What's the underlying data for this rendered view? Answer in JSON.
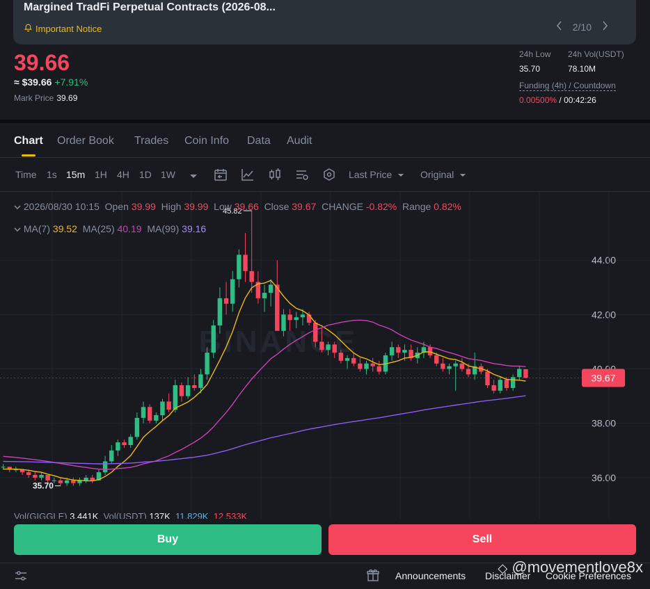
{
  "notice": {
    "title": "Margined TradFi Perpetual Contracts (2026-08...",
    "link": "Important Notice",
    "pager": "2/10"
  },
  "price": {
    "last": "39.66",
    "usd": "≈ $39.66",
    "change": "+7.91%",
    "mark_label": "Mark Price",
    "mark_value": "39.69"
  },
  "stats": {
    "low_label": "24h Low",
    "low_value": "35.70",
    "vol_label": "24h Vol(USDT)",
    "vol_value": "78.10M",
    "funding_label": "Funding (4h) / Countdown",
    "funding_rate": "0.00500%",
    "funding_sep": " / ",
    "countdown": "00:42:26"
  },
  "tabs": [
    "Chart",
    "Order Book",
    "Trades",
    "Coin Info",
    "Data",
    "Audit"
  ],
  "toolbar": {
    "time_label": "Time",
    "intervals": [
      "1s",
      "15m",
      "1H",
      "4H",
      "1D",
      "1W"
    ],
    "price_type": "Last Price",
    "view": "Original"
  },
  "ohlc": {
    "datetime": "2026/08/30 10:15",
    "open_label": "Open",
    "open": "39.99",
    "high_label": "High",
    "high": "39.99",
    "low_label": "Low",
    "low": "39.66",
    "close_label": "Close",
    "close": "39.67",
    "change_label": "CHANGE",
    "change": "-0.82%",
    "range_label": "Range",
    "range": "0.82%"
  },
  "ma": {
    "ma7_label": "MA(7)",
    "ma7": "39.52",
    "ma25_label": "MA(25)",
    "ma25": "40.19",
    "ma99_label": "MA(99)",
    "ma99": "39.16"
  },
  "volume": {
    "label": "Vol(GIGGLE)",
    "value": "3.441K",
    "usdt_label": "Vol(USDT)",
    "usdt": "137K",
    "v1": "11.829K",
    "v2": "12.533K"
  },
  "chart_data": {
    "type": "candlestick",
    "y_ticks": [
      "44.00",
      "42.00",
      "40.00",
      "38.00",
      "36.00"
    ],
    "ylim": [
      35,
      46
    ],
    "last_price_tag": "39.67",
    "high_marker": "45.82",
    "low_marker": "35.70",
    "watermark": "BINANCE",
    "colors": {
      "up": "#2ebd85",
      "down": "#f6465d",
      "ma7": "#f0b90b",
      "ma25": "#c941b5",
      "ma99": "#8b5cf6"
    },
    "candles": [
      [
        36.4,
        36.5,
        36.3,
        36.4
      ],
      [
        36.4,
        36.4,
        36.2,
        36.3
      ],
      [
        36.3,
        36.4,
        36.2,
        36.3
      ],
      [
        36.3,
        36.3,
        36.1,
        36.2
      ],
      [
        36.2,
        36.3,
        36.0,
        36.1
      ],
      [
        36.1,
        36.2,
        35.9,
        36.0
      ],
      [
        36.0,
        36.2,
        35.9,
        36.1
      ],
      [
        36.1,
        36.1,
        35.8,
        35.9
      ],
      [
        35.9,
        36.0,
        35.8,
        35.9
      ],
      [
        35.9,
        36.0,
        35.7,
        35.8
      ],
      [
        35.8,
        36.0,
        35.7,
        35.9
      ],
      [
        35.9,
        36.0,
        35.7,
        35.8
      ],
      [
        35.8,
        36.0,
        35.7,
        35.9
      ],
      [
        35.9,
        36.1,
        35.8,
        36.0
      ],
      [
        36.0,
        36.1,
        35.8,
        35.9
      ],
      [
        35.9,
        36.3,
        35.9,
        36.2
      ],
      [
        36.2,
        36.8,
        36.1,
        36.6
      ],
      [
        36.6,
        37.2,
        36.5,
        37.0
      ],
      [
        37.0,
        37.4,
        36.8,
        37.3
      ],
      [
        37.3,
        37.4,
        37.1,
        37.2
      ],
      [
        37.2,
        37.6,
        37.1,
        37.5
      ],
      [
        37.5,
        38.4,
        37.4,
        38.2
      ],
      [
        38.2,
        38.8,
        38.0,
        38.6
      ],
      [
        38.6,
        38.7,
        38.0,
        38.1
      ],
      [
        38.1,
        38.4,
        38.0,
        38.3
      ],
      [
        38.3,
        38.9,
        38.1,
        38.8
      ],
      [
        38.8,
        39.1,
        38.4,
        38.5
      ],
      [
        38.5,
        39.6,
        38.4,
        39.4
      ],
      [
        39.4,
        39.5,
        38.8,
        39.0
      ],
      [
        39.0,
        39.7,
        38.9,
        39.4
      ],
      [
        39.4,
        39.8,
        39.2,
        39.3
      ],
      [
        39.3,
        40.0,
        39.1,
        39.8
      ],
      [
        39.8,
        40.8,
        39.6,
        40.6
      ],
      [
        40.6,
        41.8,
        40.4,
        41.6
      ],
      [
        41.6,
        43.0,
        41.3,
        42.6
      ],
      [
        42.6,
        43.2,
        42.0,
        42.4
      ],
      [
        42.4,
        43.6,
        42.1,
        43.3
      ],
      [
        43.3,
        44.4,
        43.0,
        44.2
      ],
      [
        44.2,
        45.0,
        43.2,
        43.6
      ],
      [
        43.6,
        45.82,
        42.8,
        43.2
      ],
      [
        43.2,
        43.6,
        42.4,
        42.6
      ],
      [
        42.6,
        43.1,
        42.1,
        42.8
      ],
      [
        42.8,
        43.3,
        42.3,
        43.1
      ],
      [
        43.1,
        44.0,
        41.6,
        41.4
      ],
      [
        41.4,
        42.2,
        41.2,
        42.0
      ],
      [
        42.0,
        42.2,
        41.4,
        41.8
      ],
      [
        41.8,
        42.1,
        41.5,
        41.9
      ],
      [
        41.9,
        42.2,
        41.6,
        42.0
      ],
      [
        42.0,
        42.1,
        41.6,
        41.7
      ],
      [
        41.7,
        41.8,
        40.8,
        41.0
      ],
      [
        41.0,
        41.5,
        40.6,
        40.7
      ],
      [
        40.7,
        41.0,
        40.5,
        40.9
      ],
      [
        40.9,
        41.0,
        40.4,
        40.6
      ],
      [
        40.6,
        40.7,
        40.2,
        40.3
      ],
      [
        40.3,
        40.5,
        40.0,
        40.4
      ],
      [
        40.4,
        40.6,
        40.1,
        40.2
      ],
      [
        40.2,
        40.4,
        39.9,
        40.0
      ],
      [
        40.0,
        40.3,
        39.8,
        40.2
      ],
      [
        40.2,
        40.4,
        39.9,
        40.1
      ],
      [
        40.1,
        40.3,
        39.8,
        39.9
      ],
      [
        39.9,
        40.6,
        39.8,
        40.5
      ],
      [
        40.5,
        41.0,
        40.3,
        40.8
      ],
      [
        40.8,
        40.9,
        40.4,
        40.6
      ],
      [
        40.6,
        40.9,
        40.3,
        40.7
      ],
      [
        40.7,
        40.9,
        40.3,
        40.4
      ],
      [
        40.4,
        40.8,
        40.2,
        40.6
      ],
      [
        40.6,
        41.0,
        40.4,
        40.8
      ],
      [
        40.8,
        40.9,
        40.4,
        40.5
      ],
      [
        40.5,
        40.6,
        40.1,
        40.2
      ],
      [
        40.2,
        40.4,
        39.9,
        40.0
      ],
      [
        40.0,
        40.2,
        39.8,
        40.1
      ],
      [
        40.1,
        40.3,
        39.2,
        40.2
      ],
      [
        40.2,
        40.4,
        39.9,
        40.0
      ],
      [
        40.0,
        40.2,
        39.7,
        39.8
      ],
      [
        39.8,
        40.6,
        39.6,
        40.1
      ],
      [
        40.1,
        40.2,
        39.8,
        39.9
      ],
      [
        39.9,
        40.0,
        39.3,
        39.4
      ],
      [
        39.4,
        39.6,
        39.1,
        39.2
      ],
      [
        39.2,
        39.7,
        39.1,
        39.6
      ],
      [
        39.6,
        39.7,
        39.2,
        39.3
      ],
      [
        39.3,
        39.8,
        39.2,
        39.7
      ],
      [
        39.7,
        40.1,
        39.6,
        40.0
      ],
      [
        39.99,
        39.99,
        39.66,
        39.67
      ]
    ]
  },
  "buttons": {
    "buy": "Buy",
    "sell": "Sell"
  },
  "footer": {
    "announcements": "Announcements",
    "disclaimer": "Disclaimer",
    "cookies": "Cookie Preferences",
    "watermark": "@movementlove8x"
  }
}
